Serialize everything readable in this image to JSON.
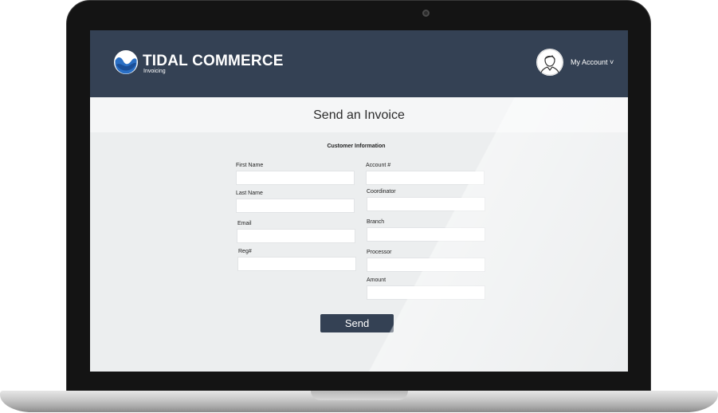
{
  "header": {
    "brand": "TIDAL COMMERCE",
    "subtitle": "Invoicing",
    "account_label": "My Account ˅"
  },
  "page": {
    "title": "Send an Invoice",
    "section_title": "Customer Information"
  },
  "form": {
    "left_fields": [
      {
        "label": "First Name",
        "value": ""
      },
      {
        "label": "Last Name",
        "value": ""
      },
      {
        "label": "Email",
        "value": ""
      },
      {
        "label": "Reg#",
        "value": ""
      }
    ],
    "right_fields": [
      {
        "label": "Account #",
        "value": ""
      },
      {
        "label": "Coordinator",
        "value": ""
      },
      {
        "label": "Branch",
        "value": ""
      },
      {
        "label": "Processor",
        "value": ""
      },
      {
        "label": "Amount",
        "value": ""
      }
    ],
    "submit_label": "Send"
  },
  "colors": {
    "header_bg": "#344154",
    "content_bg": "#eceeef",
    "accent": "#1e88e5"
  },
  "icons": {
    "logo": "tidal-wave-logo-icon",
    "avatar": "user-avatar-icon",
    "camera": "webcam-icon"
  }
}
